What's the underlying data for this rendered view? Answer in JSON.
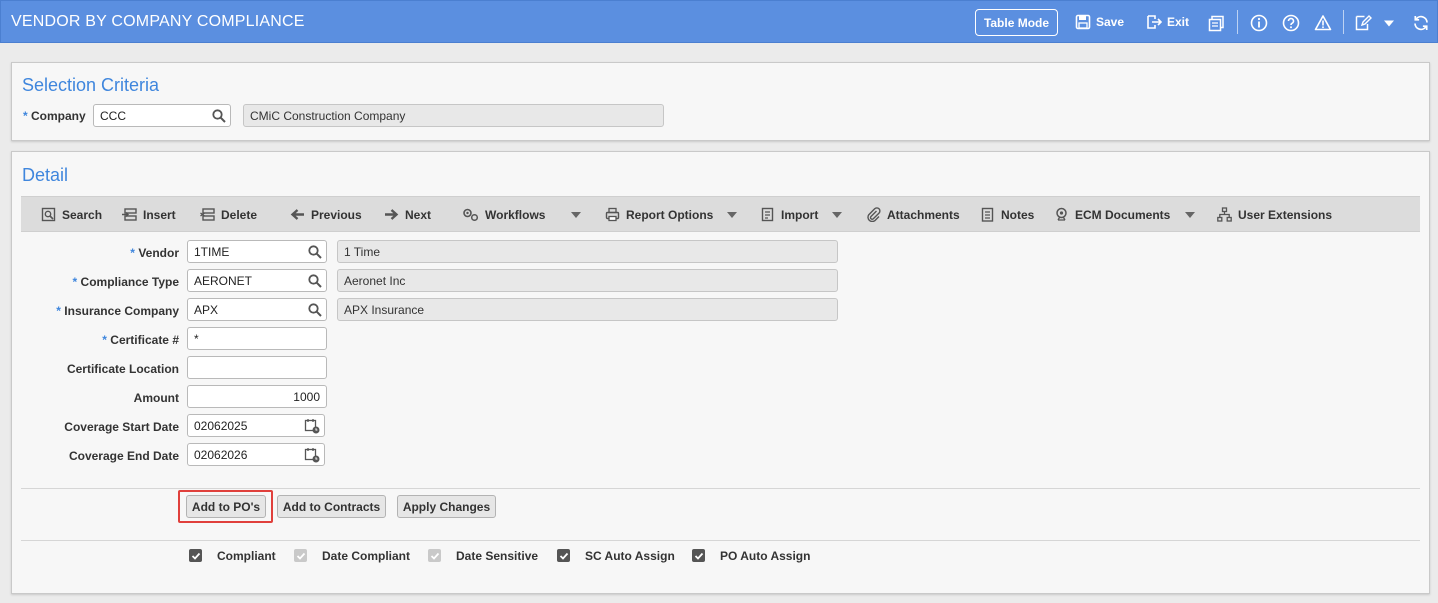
{
  "header": {
    "title": "VENDOR BY COMPANY COMPLIANCE",
    "table_mode": "Table Mode",
    "save": "Save",
    "exit": "Exit"
  },
  "selection": {
    "title": "Selection Criteria",
    "company_label": "Company",
    "company_value": "CCC",
    "company_name": "CMiC Construction Company"
  },
  "detail": {
    "title": "Detail",
    "toolbar": {
      "search": "Search",
      "insert": "Insert",
      "delete": "Delete",
      "previous": "Previous",
      "next": "Next",
      "workflows": "Workflows",
      "report_options": "Report Options",
      "import": "Import",
      "attachments": "Attachments",
      "notes": "Notes",
      "ecm_documents": "ECM Documents",
      "user_extensions": "User Extensions"
    },
    "fields": {
      "vendor_label": "Vendor",
      "vendor_value": "1TIME",
      "vendor_name": "1 Time",
      "compliance_type_label": "Compliance Type",
      "compliance_type_value": "AERONET",
      "compliance_type_name": "Aeronet Inc",
      "insurance_company_label": "Insurance Company",
      "insurance_company_value": "APX",
      "insurance_company_name": "APX Insurance",
      "certificate_label": "Certificate #",
      "certificate_value": "*",
      "certificate_location_label": "Certificate Location",
      "certificate_location_value": "",
      "amount_label": "Amount",
      "amount_value": "1000",
      "coverage_start_label": "Coverage Start Date",
      "coverage_start_value": "02062025",
      "coverage_end_label": "Coverage End Date",
      "coverage_end_value": "02062026"
    },
    "buttons": {
      "add_to_pos": "Add to PO's",
      "add_to_contracts": "Add to Contracts",
      "apply_changes": "Apply Changes"
    },
    "checkboxes": {
      "compliant": "Compliant",
      "date_compliant": "Date Compliant",
      "date_sensitive": "Date Sensitive",
      "sc_auto_assign": "SC Auto Assign",
      "po_auto_assign": "PO Auto Assign"
    }
  },
  "colors": {
    "header_bg": "#5b8fe0",
    "accent": "#3f86dd",
    "highlight": "#e0403c"
  }
}
